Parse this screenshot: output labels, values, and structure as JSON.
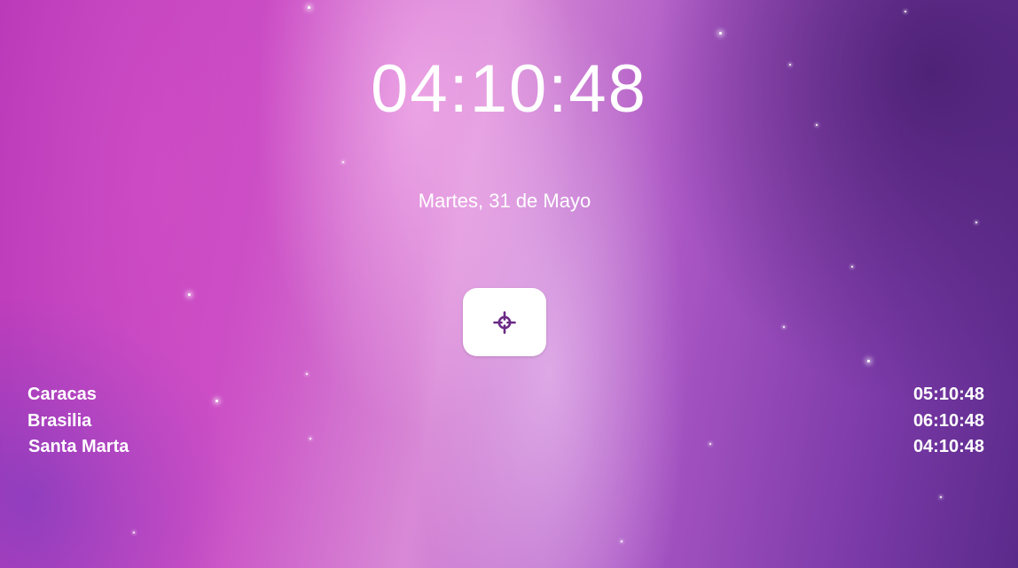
{
  "clock": {
    "time": "04:10:48",
    "date": "Martes, 31 de Mayo"
  },
  "locate_button": {
    "icon": "crosshair-icon",
    "icon_color": "#6b2a86"
  },
  "zones": [
    {
      "city": "Caracas",
      "time": "05:10:48"
    },
    {
      "city": "Brasilia",
      "time": "06:10:48"
    },
    {
      "city": "Santa Marta",
      "time": "04:10:48"
    }
  ]
}
